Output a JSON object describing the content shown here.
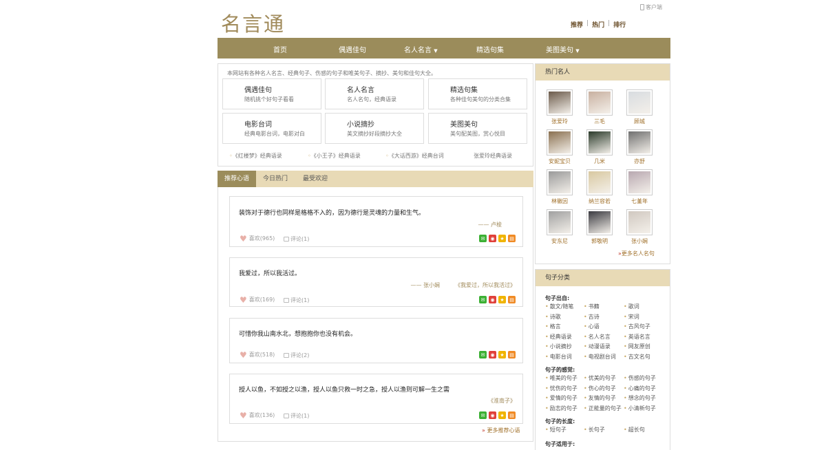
{
  "site": {
    "logo": "名言通",
    "client_link": "客户端"
  },
  "top_nav": [
    "推荐",
    "热门",
    "排行"
  ],
  "main_nav": [
    {
      "label": "首页",
      "dropdown": false
    },
    {
      "label": "偶遇佳句",
      "dropdown": false
    },
    {
      "label": "名人名言",
      "dropdown": true
    },
    {
      "label": "精选句集",
      "dropdown": false
    },
    {
      "label": "美图美句",
      "dropdown": true
    }
  ],
  "dropdown_arrow": "▼",
  "intro": "本网站有各种名人名言、经典句子、伤感的句子和唯美句子、摘抄、美句和佳句大全。",
  "categories": [
    {
      "title": "偶遇佳句",
      "desc": "随机挑个好句子看看"
    },
    {
      "title": "名人名言",
      "desc": "名人名句，经典语录"
    },
    {
      "title": "精选句集",
      "desc": "各种佳句美句的分类合集"
    },
    {
      "title": "电影台词",
      "desc": "经典电影台词，电影对白"
    },
    {
      "title": "小说摘抄",
      "desc": "美文摘抄好段摘抄大全"
    },
    {
      "title": "美图美句",
      "desc": "美句配美图，赏心悦目"
    }
  ],
  "quick_links": [
    "《红楼梦》经典语录",
    "《小王子》经典语录",
    "《大话西游》经典台词",
    "张爱玲经典语录"
  ],
  "tabs": [
    "推荐心语",
    "今日热门",
    "最受欢迎"
  ],
  "quotes": [
    {
      "text": "装饰对于德行也同样是格格不入的，因为德行是灵魂的力量和生气。",
      "author": "—— 卢梭",
      "source": "",
      "likes": "喜欢(965)",
      "comments": "评论(1)"
    },
    {
      "text": "我爱过，所以我活过。",
      "author": "—— 张小娴",
      "source": "《我爱过，所以我活过》",
      "likes": "喜欢(169)",
      "comments": "评论(1)"
    },
    {
      "text": "可惜你我山南水北，想抱抱你也没有机会。",
      "author": "",
      "source": "",
      "likes": "喜欢(518)",
      "comments": "评论(2)"
    },
    {
      "text": "授人以鱼，不如授之以渔，授人以鱼只救一时之急，授人以渔则可解一生之需",
      "author": "",
      "source": "《淮南子》",
      "likes": "喜欢(136)",
      "comments": "评论(1)"
    }
  ],
  "more_quotes": "更多推荐心语",
  "hot_people": {
    "title": "热门名人",
    "people": [
      "张爱玲",
      "三毛",
      "顾城",
      "安妮宝贝",
      "几米",
      "亦舒",
      "林徽因",
      "纳兰容若",
      "七堇年",
      "安东尼",
      "郭敬明",
      "张小娴"
    ],
    "more": "更多名人名句"
  },
  "sentence_categories": {
    "title": "句子分类",
    "from": {
      "label": "句子出自:",
      "items": [
        "散文/随笔",
        "书籍",
        "歌词",
        "诗歌",
        "古诗",
        "宋词",
        "格言",
        "心语",
        "古风句子",
        "经典语录",
        "名人名言",
        "英语名言",
        "小说摘抄",
        "动漫语录",
        "网友原创",
        "电影台词",
        "电视剧台词",
        "古文名句"
      ]
    },
    "feel": {
      "label": "句子的感觉:",
      "items": [
        "唯美的句子",
        "优美的句子",
        "伤感的句子",
        "忧伤的句子",
        "伤心的句子",
        "心痛的句子",
        "爱情的句子",
        "友情的句子",
        "想念的句子",
        "励志的句子",
        "正能量的句子",
        "小清新句子"
      ]
    },
    "length": {
      "label": "句子的长度:",
      "items": [
        "短句子",
        "长句子",
        "超长句"
      ]
    },
    "use": {
      "label": "句子适用于:"
    }
  },
  "colors": {
    "nav": "#9b8c5b",
    "tab_bar": "#e8dab6",
    "link": "#a0702a",
    "logo": "#a08a5a"
  }
}
